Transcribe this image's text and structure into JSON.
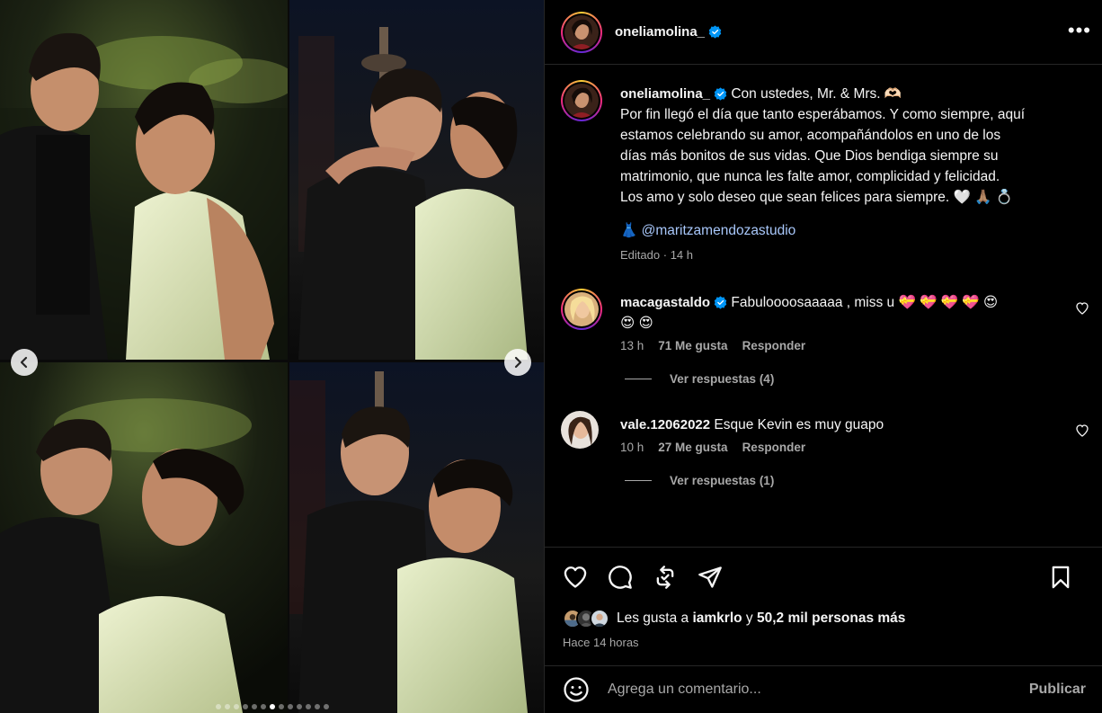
{
  "post": {
    "author": "oneliamolina_",
    "more_label": "•••"
  },
  "caption": {
    "username": "oneliamolina_",
    "lines": [
      "Con ustedes, Mr. & Mrs. 🫶🏻",
      "Por fin llegó el día que tanto esperábamos. Y como siempre, aquí",
      "estamos celebrando su amor, acompañándolos en uno de los",
      "días más bonitos de sus vidas. Que Dios bendiga siempre su",
      "matrimonio, que nunca les falte amor, complicidad y felicidad.",
      "Los amo y solo deseo que sean felices para siempre. 🤍 🙏🏽 💍"
    ],
    "dress_emoji": "👗",
    "mention": "@maritzamendozastudio",
    "edited": "Editado",
    "separator": "·",
    "time": "14 h"
  },
  "comments": [
    {
      "username": "macagastaldo",
      "text_line1": "Fabuloooosaaaaa , miss u 💝 💝 💝 💝 😍",
      "text_line2": "😍 😍",
      "time": "13 h",
      "likes": "71 Me gusta",
      "reply": "Responder",
      "view_replies": "Ver respuestas (4)"
    },
    {
      "username": "vale.12062022",
      "text": "Esque Kevin es muy guapo",
      "time": "10 h",
      "likes": "27 Me gusta",
      "reply": "Responder",
      "view_replies": "Ver respuestas (1)"
    }
  ],
  "likes": {
    "prefix": "Les gusta a",
    "user": "iamkrlo",
    "conj": "y",
    "others": "50,2 mil personas más"
  },
  "time_ago": "Hace 14 horas",
  "comment_box": {
    "placeholder": "Agrega un comentario...",
    "post_label": "Publicar"
  },
  "carousel": {
    "total_dots": 13,
    "active_index": 6
  },
  "colors": {
    "verified": "#0095f6",
    "mention": "#a8c7fa",
    "muted": "#a8a8a8"
  }
}
